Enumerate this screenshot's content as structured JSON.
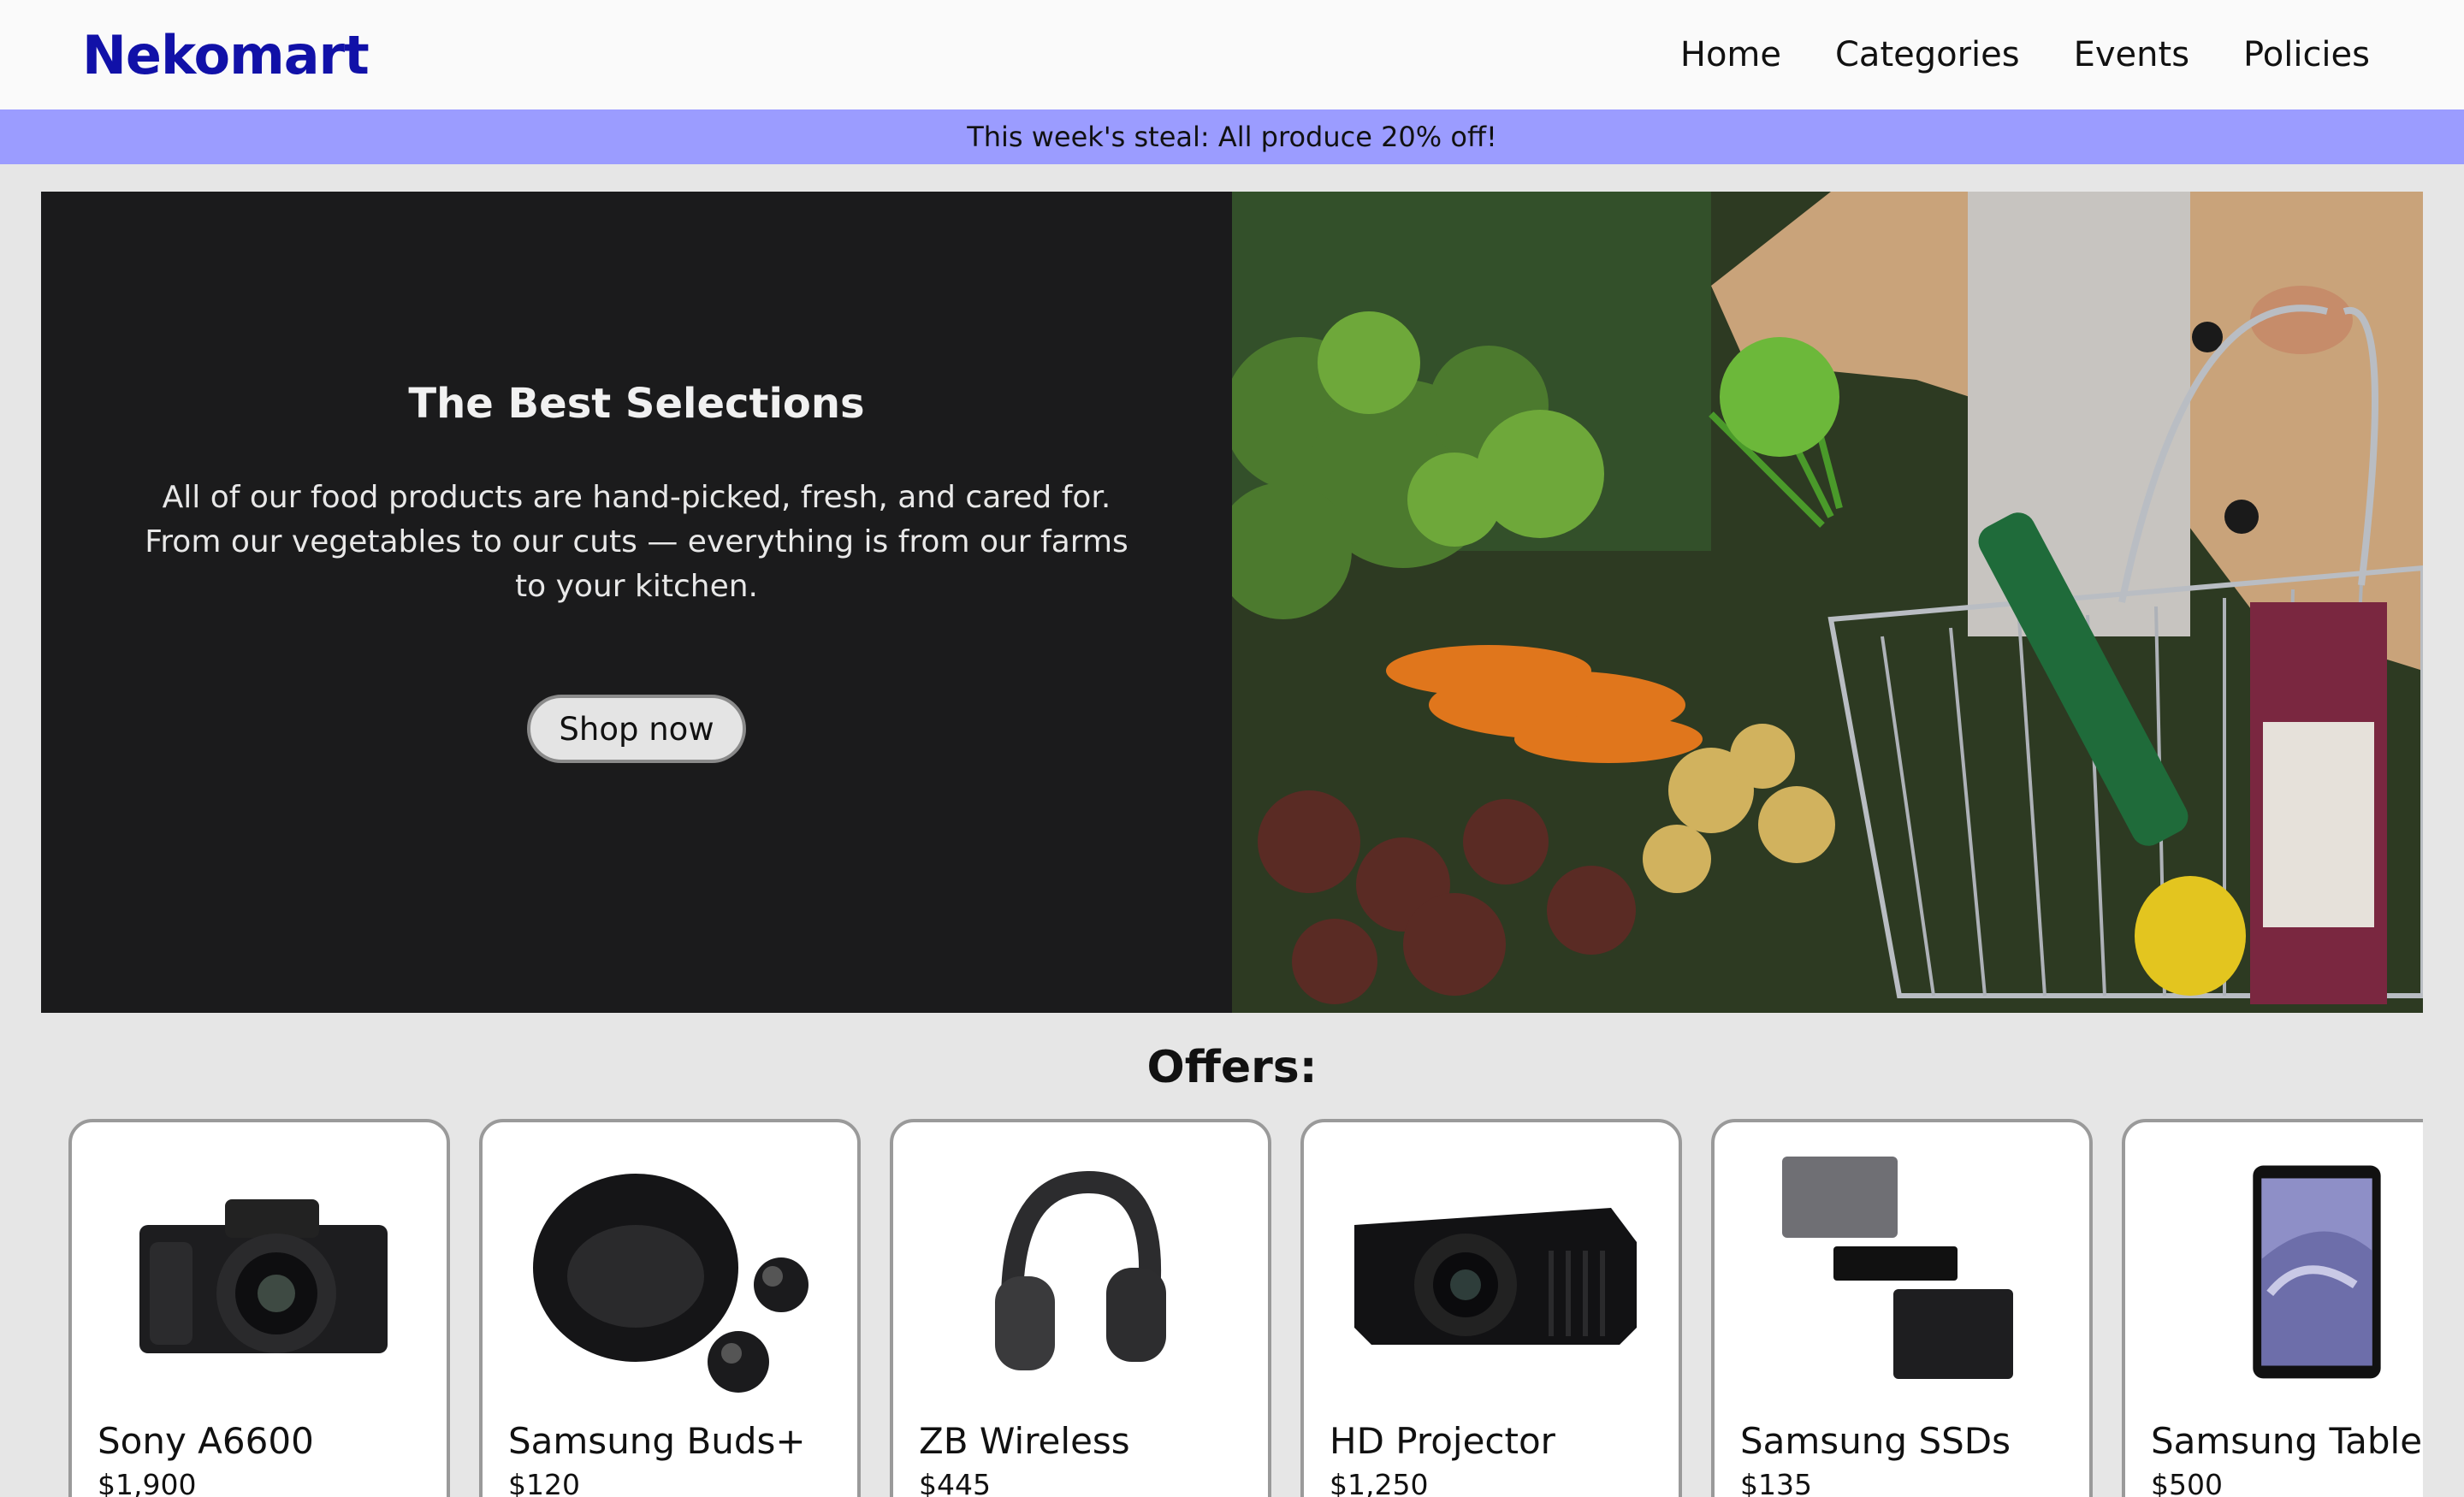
{
  "header": {
    "brand": "Nekomart",
    "nav": [
      "Home",
      "Categories",
      "Events",
      "Policies"
    ]
  },
  "promo": {
    "text": "This week's steal: All produce 20% off!"
  },
  "hero": {
    "title": "The Best Selections",
    "body": "All of our food products are hand-picked, fresh, and cared for. From our vegetables to our cuts — everything is from our farms to your kitchen.",
    "button": "Shop now",
    "image_icon": "grocery-basket-photo"
  },
  "offers": {
    "title": "Offers:",
    "items": [
      {
        "name": "Sony A6600",
        "price": "$1,900",
        "icon": "camera-icon"
      },
      {
        "name": "Samsung Buds+",
        "price": "$120",
        "icon": "earbuds-icon"
      },
      {
        "name": "ZB Wireless",
        "price": "$445",
        "icon": "headphones-icon"
      },
      {
        "name": "HD Projector",
        "price": "$1,250",
        "icon": "projector-icon"
      },
      {
        "name": "Samsung SSDs",
        "price": "$135",
        "icon": "ssd-icon"
      },
      {
        "name": "Samsung Tablets",
        "price": "$500",
        "icon": "tablet-icon"
      }
    ]
  },
  "colors": {
    "brand": "#1111a8",
    "promo_bg": "#9b9cff",
    "hero_bg": "#1b1b1c",
    "page_bg": "#e6e6e6"
  }
}
